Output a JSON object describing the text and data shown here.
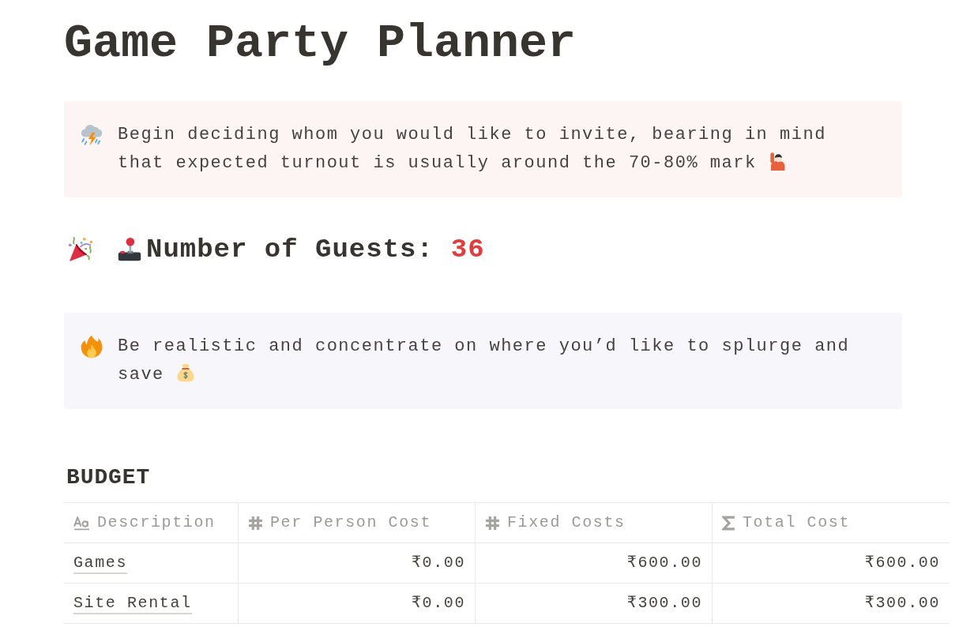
{
  "title": "Game Party Planner",
  "callouts": [
    {
      "kind": "invite",
      "color": "#fdf5f3",
      "text": "Begin deciding whom you would like to invite, bearing in mind that expected turnout is usually around the 70-80% mark"
    },
    {
      "kind": "budget",
      "color": "#f7f6fb",
      "text": "Be realistic and concentrate on where you’d like to splurge and save"
    }
  ],
  "guests": {
    "label": "Number of Guests:",
    "count": "36"
  },
  "budget": {
    "title": "BUDGET",
    "columns": [
      {
        "kind": "text",
        "label": "Description"
      },
      {
        "kind": "number",
        "label": "Per Person Cost"
      },
      {
        "kind": "number",
        "label": "Fixed Costs"
      },
      {
        "kind": "formula",
        "label": "Total Cost"
      }
    ],
    "rows": [
      [
        "Games",
        "₹0.00",
        "₹600.00",
        "₹600.00"
      ],
      [
        "Site Rental",
        "₹0.00",
        "₹300.00",
        "₹300.00"
      ]
    ]
  }
}
